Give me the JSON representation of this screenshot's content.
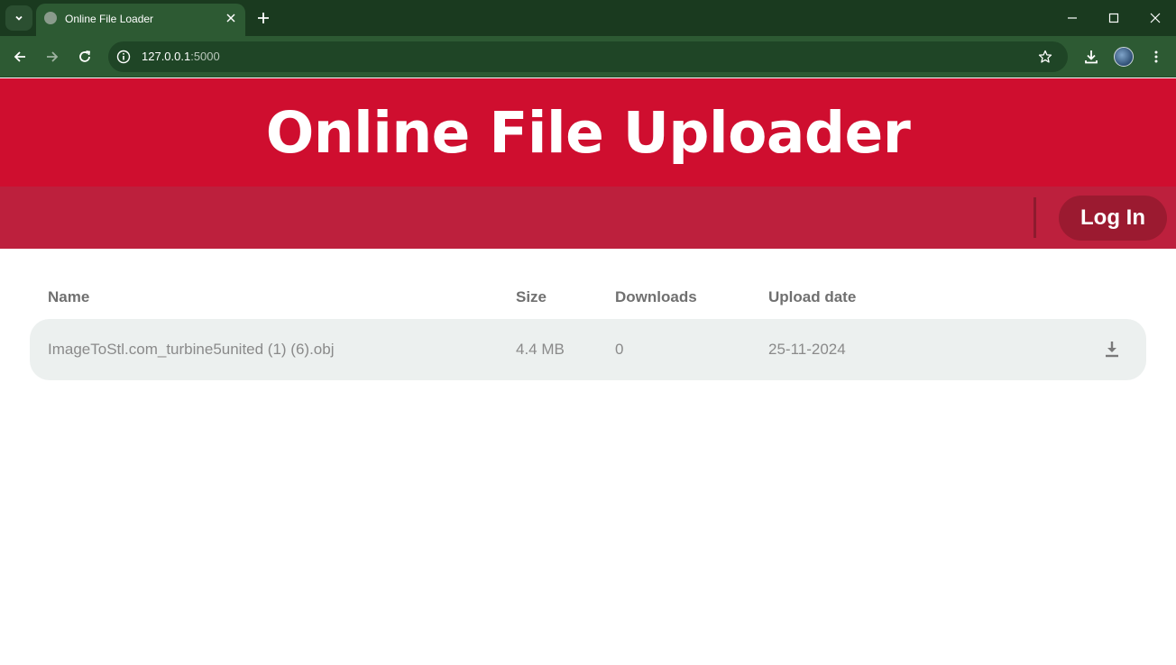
{
  "browser": {
    "tab_title": "Online File Loader",
    "url_host": "127.0.0.1",
    "url_port": ":5000",
    "colors": {
      "tabstrip": "#1a3a1f",
      "toolbar": "#2d5a33"
    }
  },
  "page": {
    "title": "Online File Uploader",
    "login_label": "Log In",
    "colors": {
      "hero": "#cf0e2f",
      "navbar": "#bd203d",
      "login_button": "#9b1a30"
    }
  },
  "table": {
    "columns": [
      "Name",
      "Size",
      "Downloads",
      "Upload date"
    ],
    "rows": [
      {
        "name": "ImageToStl.com_turbine5united (1) (6).obj",
        "size": "4.4 MB",
        "downloads": "0",
        "upload_date": "25-11-2024",
        "action_icon": "download-icon"
      }
    ]
  }
}
